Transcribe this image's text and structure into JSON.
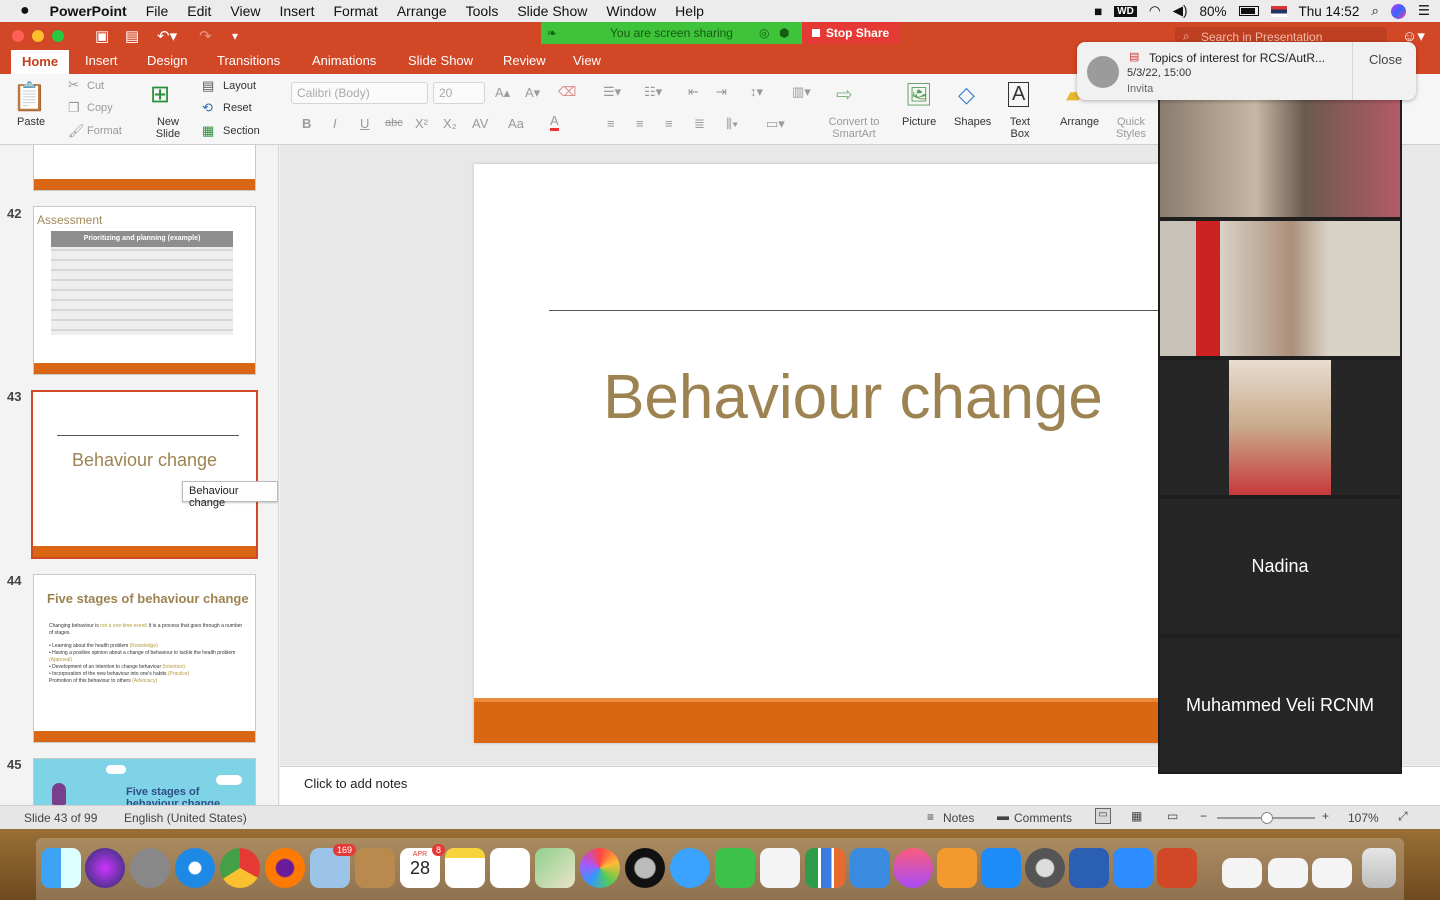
{
  "menubar": {
    "app": "PowerPoint",
    "items": [
      "File",
      "Edit",
      "View",
      "Insert",
      "Format",
      "Arrange",
      "Tools",
      "Slide Show",
      "Window",
      "Help"
    ],
    "battery": "80%",
    "clock": "Thu 14:52"
  },
  "share": {
    "status": "You are screen sharing",
    "stop": "Stop Share"
  },
  "search": {
    "placeholder": "Search in Presentation"
  },
  "tabs": [
    "Home",
    "Insert",
    "Design",
    "Transitions",
    "Animations",
    "Slide Show",
    "Review",
    "View"
  ],
  "ribbon": {
    "paste": "Paste",
    "cut": "Cut",
    "copy": "Copy",
    "format": "Format",
    "new_slide": "New Slide",
    "layout": "Layout",
    "reset": "Reset",
    "section": "Section",
    "font": "Calibri (Body)",
    "size": "20",
    "convert": "Convert to SmartArt",
    "picture": "Picture",
    "shapes": "Shapes",
    "textbox": "Text Box",
    "arrange": "Arrange",
    "quick": "Quick Styles"
  },
  "thumbs": {
    "n42": "42",
    "n43": "43",
    "n44": "44",
    "n45": "45",
    "t42_label": "Assessment",
    "t42_inner": "Prioritizing and planning (example)",
    "t43_title": "Behaviour change",
    "t44_title": "Five stages of behaviour change",
    "t44_l1a": "Changing behaviour is ",
    "t44_l1b": "not a one-time event!",
    "t44_l1c": " It is a process that goes through a number of stages.",
    "t44_b1": "Learning about the health problem ",
    "t44_b1k": "(Knowledge)",
    "t44_b2": "Having a positive opinion about a change of behaviour to tackle the health problem ",
    "t44_b2k": "(Approval)",
    "t44_b3": "Development of an intention to change behaviour ",
    "t44_b3k": "(Intention)",
    "t44_b4": "Incorporation of the new behaviour into one's habits ",
    "t44_b4k": "(Practice)",
    "t44_b5": "Promotion of this behaviour to others ",
    "t44_b5k": "(Advocacy)",
    "t45_title": "Five stages of behaviour change"
  },
  "tooltip": "Behaviour change",
  "slide": {
    "title": "Behaviour change"
  },
  "notes": "Click to add notes",
  "status": {
    "slide": "Slide 43 of 99",
    "lang": "English (United States)",
    "notes": "Notes",
    "comments": "Comments",
    "zoom": "107%"
  },
  "notification": {
    "title": "Topics of interest for RCS/AutR...",
    "date": "5/3/22, 15:00",
    "sub": "Invita",
    "close": "Close"
  },
  "participants": {
    "p4": "Nadina",
    "p5": "Muhammed Veli RCNM"
  },
  "dock": {
    "mail_badge": "169",
    "cal_badge": "8",
    "cal_month": "APR",
    "cal_day": "28"
  },
  "colors": {
    "accent": "#d24726",
    "title_gold": "#9e8352",
    "slide_bar": "#d86613"
  }
}
